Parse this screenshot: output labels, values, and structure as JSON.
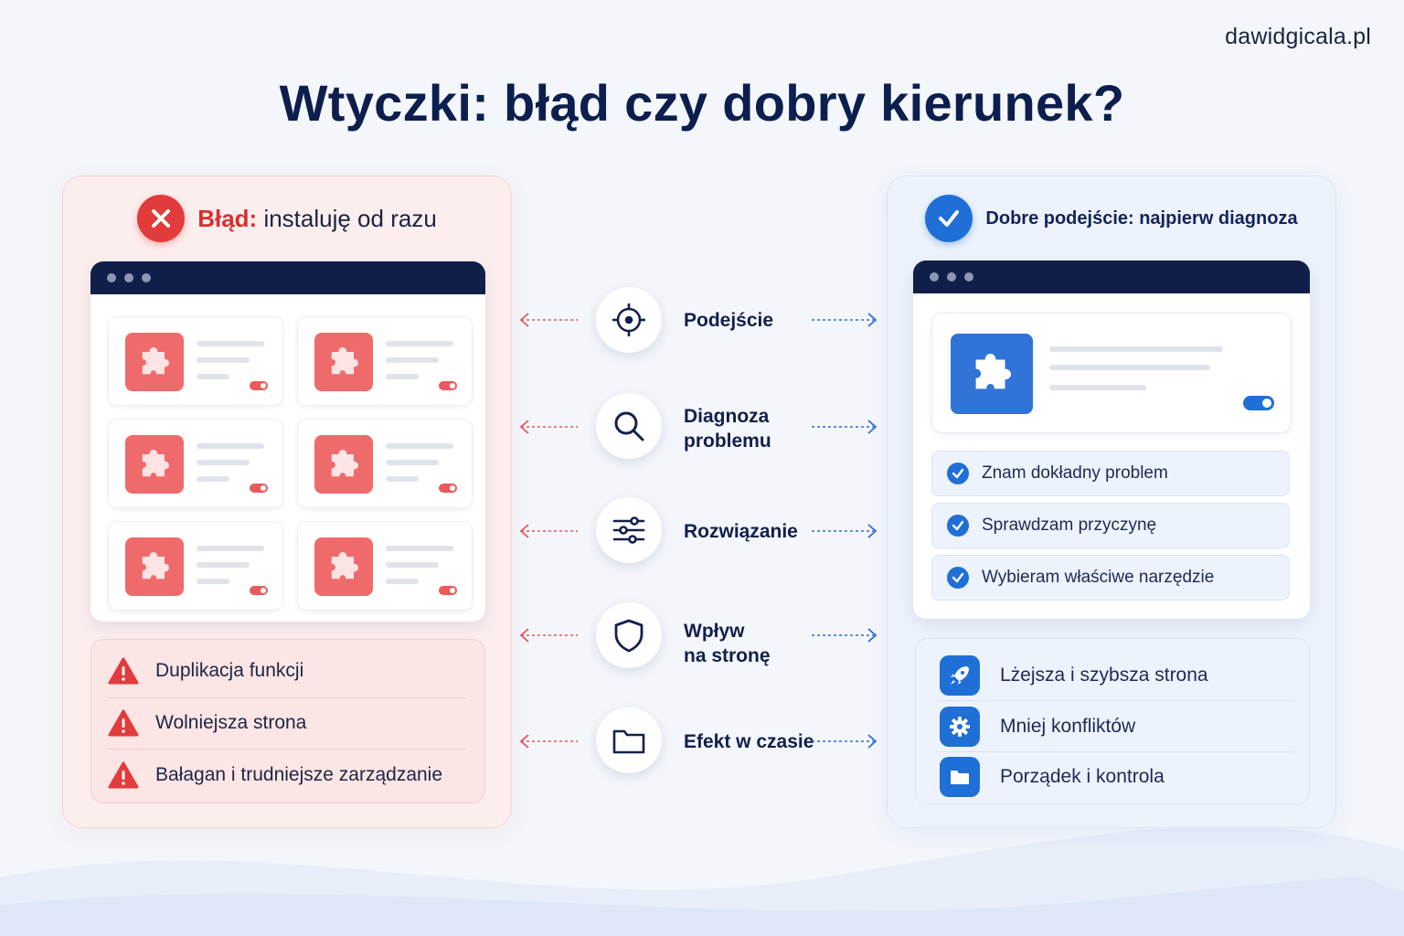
{
  "brand": "dawidgicala.pl",
  "title": "Wtyczki: błąd czy dobry kierunek?",
  "left": {
    "head_error": "Błąd:",
    "head_rest": "instaluję od razu",
    "issues": [
      "Duplikacja funkcji",
      "Wolniejsza strona",
      "Bałagan i trudniejsze zarządzanie"
    ]
  },
  "middle": {
    "items": [
      {
        "label1": "Podejście",
        "label2": "",
        "icon": "target-icon"
      },
      {
        "label1": "Diagnoza",
        "label2": "problemu",
        "icon": "search-icon"
      },
      {
        "label1": "Rozwiązanie",
        "label2": "",
        "icon": "sliders-icon"
      },
      {
        "label1": "Wpływ",
        "label2": "na stronę",
        "icon": "shield-icon"
      },
      {
        "label1": "Efekt w czasie",
        "label2": "",
        "icon": "folder-icon"
      }
    ]
  },
  "right": {
    "head": "Dobre podejście: najpierw diagnoza",
    "checks": [
      "Znam dokładny problem",
      "Sprawdzam przyczynę",
      "Wybieram właściwe narzędzie"
    ],
    "benefits": [
      {
        "label": "Lżejsza i szybsza strona",
        "icon": "rocket-icon"
      },
      {
        "label": "Mniej konfliktów",
        "icon": "gear-icon"
      },
      {
        "label": "Porządek i kontrola",
        "icon": "folder-icon"
      }
    ]
  },
  "colors": {
    "error": "#e23b3b",
    "accent": "#1f6fd6",
    "navy": "#0f1f4a"
  }
}
